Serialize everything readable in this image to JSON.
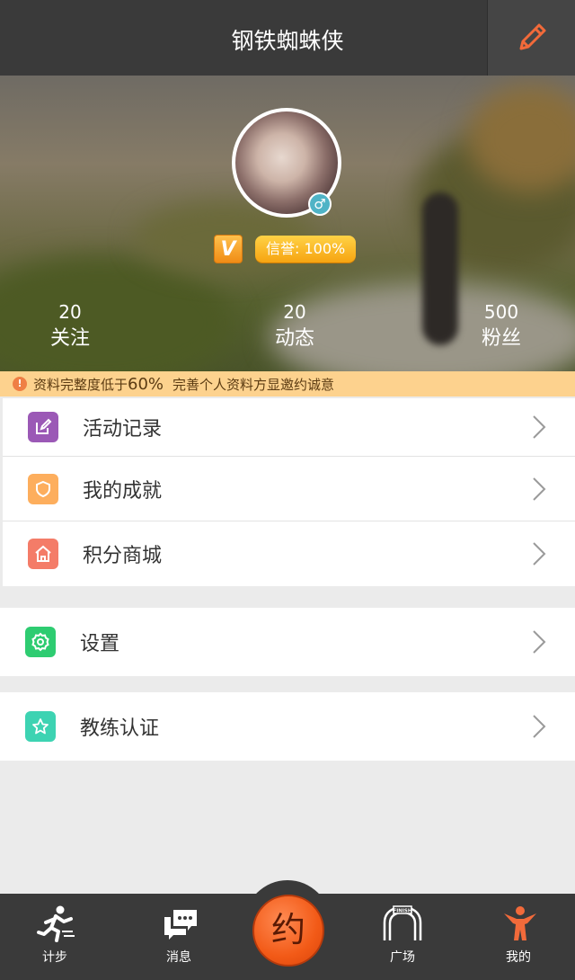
{
  "header": {
    "title": "钢铁蜘蛛侠"
  },
  "profile": {
    "gender_symbol": "♂",
    "vip_level": "V",
    "credit": "信誉: 100%"
  },
  "stats": [
    {
      "count": "20",
      "label": "关注"
    },
    {
      "count": "20",
      "label": "动态"
    },
    {
      "count": "500",
      "label": "粉丝"
    }
  ],
  "notice": {
    "prefix": "资料完整度低于",
    "percent": "60%",
    "suffix": "完善个人资料方显邀约诚意"
  },
  "menu": {
    "group1": [
      {
        "label": "活动记录",
        "icon": "edit-icon",
        "color": "#9b59b6"
      },
      {
        "label": "我的成就",
        "icon": "shield-icon",
        "color": "#fdae5d"
      },
      {
        "label": "积分商城",
        "icon": "home-icon",
        "color": "#f47c68"
      }
    ],
    "group2": [
      {
        "label": "设置",
        "icon": "gear-icon",
        "color": "#2ecc71"
      }
    ],
    "group3": [
      {
        "label": "教练认证",
        "icon": "star-icon",
        "color": "#3dd3b2"
      }
    ]
  },
  "tabbar": {
    "tabs": [
      {
        "label": "计步",
        "icon": "runner-icon"
      },
      {
        "label": "消息",
        "icon": "chat-icon"
      },
      {
        "label": "广场",
        "icon": "finish-arch-icon"
      },
      {
        "label": "我的",
        "icon": "person-icon",
        "active": true
      }
    ],
    "center_label": "约",
    "active_color": "#f26a3a"
  }
}
